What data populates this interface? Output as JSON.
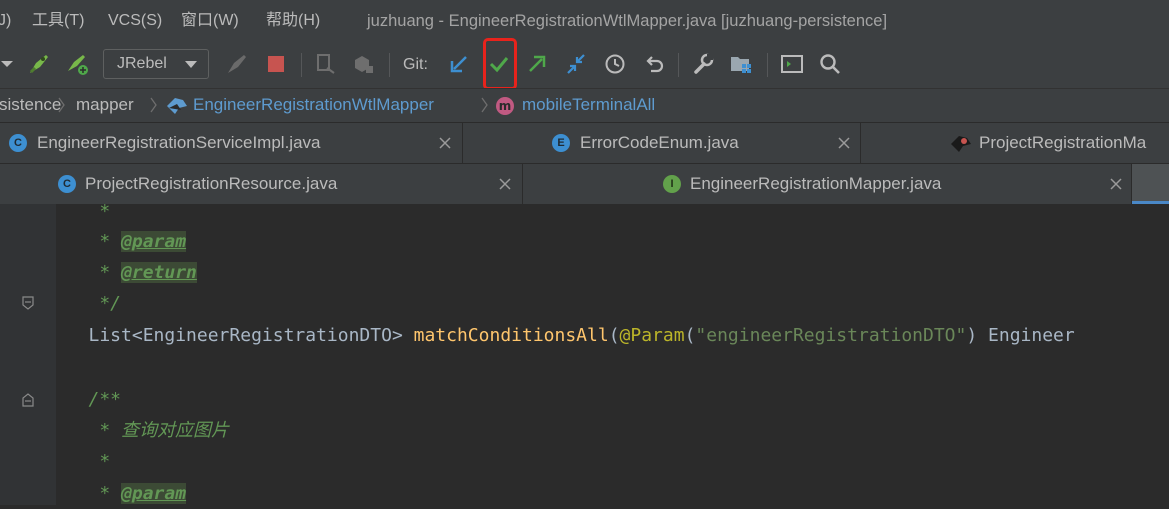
{
  "menubar": {
    "items": [
      {
        "label": "J)"
      },
      {
        "label": "工具(T)"
      },
      {
        "label": "VCS(S)"
      },
      {
        "label": "窗口(W)"
      },
      {
        "label": "帮助(H)"
      }
    ],
    "window_title": "juzhuang - EngineerRegistrationWtlMapper.java [juzhuang-persistence]"
  },
  "toolbar": {
    "run_config": "JRebel",
    "git_label": "Git:",
    "colors": {
      "update": "#3d8fd1",
      "commit": "#4fa84a",
      "push": "#4fa84a",
      "stop": "#c75450",
      "highlight": "#e8231c"
    }
  },
  "breadcrumb": {
    "items": [
      {
        "label": "sistence"
      },
      {
        "label": "mapper"
      },
      {
        "label": "EngineerRegistrationWtlMapper"
      },
      {
        "label": "mobileTerminalAll"
      }
    ]
  },
  "tabs": {
    "row1": [
      {
        "label": "EngineerRegistrationServiceImpl.java",
        "icon": "C"
      },
      {
        "label": "ErrorCodeEnum.java",
        "icon": "E"
      },
      {
        "label": "ProjectRegistrationMa",
        "icon": "mapper"
      }
    ],
    "row2": [
      {
        "label": "ProjectRegistrationResource.java",
        "icon": "C"
      },
      {
        "label": "EngineerRegistrationMapper.java",
        "icon": "I"
      }
    ]
  },
  "editor": {
    "lines": {
      "l1": "    *",
      "l2_star": "    * ",
      "l2_tag": "@param",
      "l3_star": "    * ",
      "l3_tag": "@return",
      "l4": "    */",
      "l5_type": "   List<EngineerRegistrationDTO> ",
      "l5_method": "matchConditionsAll",
      "l5_paren": "(",
      "l5_anno": "@Param",
      "l5_lp": "(",
      "l5_str": "\"engineerRegistrationDTO\"",
      "l5_rest": ") Engineer",
      "l7": "   /**",
      "l8": "    * 查询对应图片",
      "l9": "    *",
      "l10_star": "    * ",
      "l10_tag": "@param"
    }
  }
}
